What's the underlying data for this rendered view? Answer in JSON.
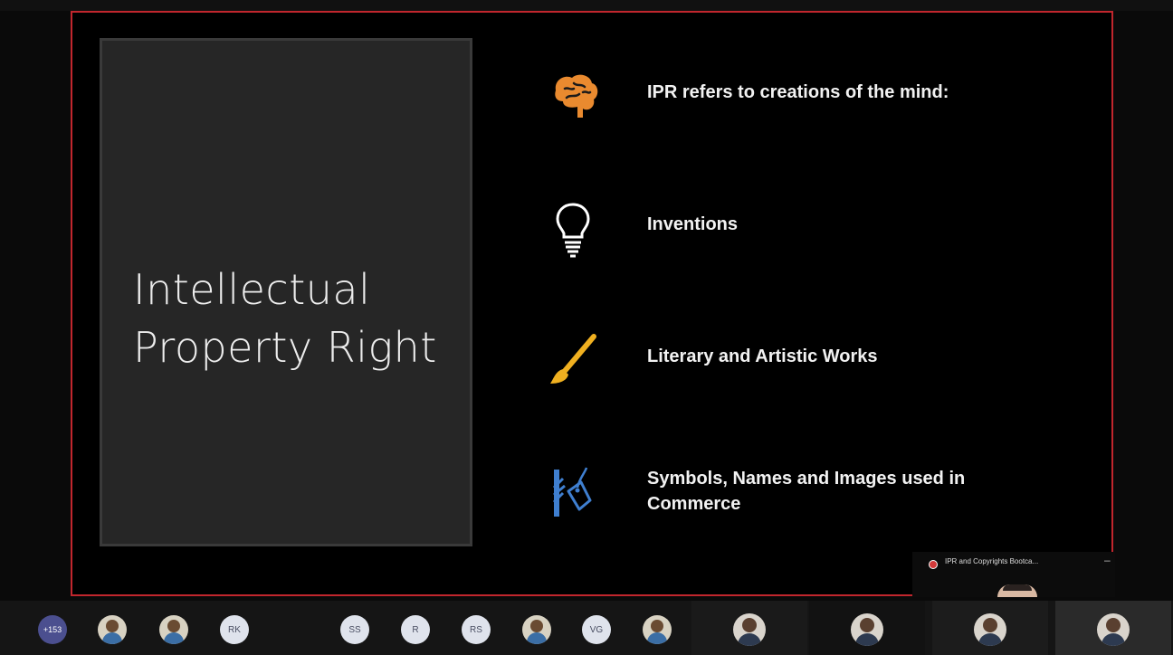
{
  "slide": {
    "title_line1": "Intellectual",
    "title_line2": "Property Right",
    "bullets": [
      {
        "icon": "brain-icon",
        "text": "IPR refers to creations of the mind:",
        "color": "#e98a2f"
      },
      {
        "icon": "lightbulb-icon",
        "text": "Inventions",
        "color": "#ffffff"
      },
      {
        "icon": "paintbrush-icon",
        "text": "Literary and Artistic Works",
        "color": "#f0b020"
      },
      {
        "icon": "tag-icon",
        "text": "Symbols, Names and Images used in",
        "text2": "Commerce",
        "color": "#3f7fd0"
      }
    ]
  },
  "recording": {
    "label": "IPR and Copyrights Bootca...",
    "minimize": "–"
  },
  "participants": {
    "overflow_count": "+153",
    "initials": [
      "RK",
      "SS",
      "R",
      "RS",
      "VG"
    ]
  },
  "colors": {
    "share_border": "#c1262d",
    "title_card_bg": "#262626"
  }
}
